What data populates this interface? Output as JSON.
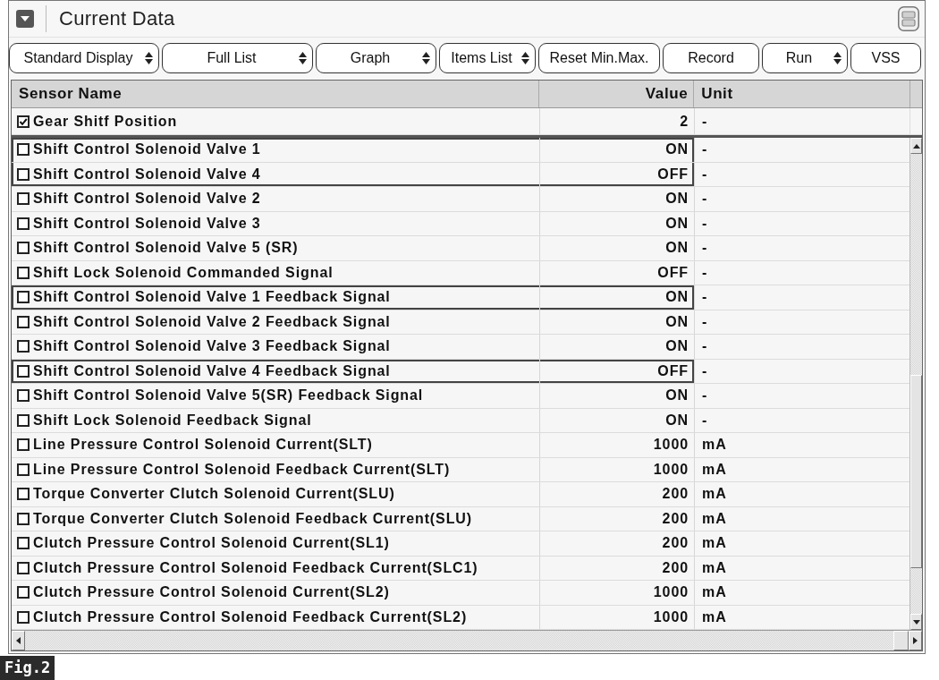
{
  "window": {
    "title": "Current Data"
  },
  "toolbar": [
    {
      "label": "Standard Display",
      "kind": "dropdown"
    },
    {
      "label": "Full List",
      "kind": "dropdown"
    },
    {
      "label": "Graph",
      "kind": "dropdown"
    },
    {
      "label": "Items List",
      "kind": "dropdown"
    },
    {
      "label": "Reset Min.Max.",
      "kind": "button"
    },
    {
      "label": "Record",
      "kind": "button"
    },
    {
      "label": "Run",
      "kind": "dropdown"
    },
    {
      "label": "VSS",
      "kind": "button"
    }
  ],
  "table": {
    "columns": [
      "Sensor Name",
      "Value",
      "Unit"
    ],
    "pinned_row": {
      "name": "Gear Shitf Position",
      "value": "2",
      "unit": "-",
      "checked": true
    },
    "rows": [
      {
        "name": "Shift Control Solenoid Valve 1",
        "value": "ON",
        "unit": "-",
        "checked": false,
        "highlighted": true
      },
      {
        "name": "Shift Control Solenoid Valve 4",
        "value": "OFF",
        "unit": "-",
        "checked": false,
        "highlighted": true
      },
      {
        "name": "Shift Control Solenoid Valve 2",
        "value": "ON",
        "unit": "-",
        "checked": false,
        "highlighted": false
      },
      {
        "name": "Shift Control Solenoid Valve 3",
        "value": "ON",
        "unit": "-",
        "checked": false,
        "highlighted": false
      },
      {
        "name": "Shift Control Solenoid Valve 5 (SR)",
        "value": "ON",
        "unit": "-",
        "checked": false,
        "highlighted": false
      },
      {
        "name": "Shift Lock Solenoid Commanded Signal",
        "value": "OFF",
        "unit": "-",
        "checked": false,
        "highlighted": false
      },
      {
        "name": "Shift Control Solenoid Valve 1 Feedback Signal",
        "value": "ON",
        "unit": "-",
        "checked": false,
        "highlighted": true
      },
      {
        "name": "Shift Control Solenoid Valve 2 Feedback Signal",
        "value": "ON",
        "unit": "-",
        "checked": false,
        "highlighted": false
      },
      {
        "name": "Shift Control Solenoid Valve 3 Feedback Signal",
        "value": "ON",
        "unit": "-",
        "checked": false,
        "highlighted": false
      },
      {
        "name": "Shift Control Solenoid Valve 4 Feedback Signal",
        "value": "OFF",
        "unit": "-",
        "checked": false,
        "highlighted": true
      },
      {
        "name": "Shift Control Solenoid Valve 5(SR) Feedback Signal",
        "value": "ON",
        "unit": "-",
        "checked": false,
        "highlighted": false
      },
      {
        "name": "Shift Lock Solenoid Feedback Signal",
        "value": "ON",
        "unit": "-",
        "checked": false,
        "highlighted": false
      },
      {
        "name": "Line Pressure Control Solenoid Current(SLT)",
        "value": "1000",
        "unit": "mA",
        "checked": false,
        "highlighted": false
      },
      {
        "name": "Line Pressure Control Solenoid Feedback Current(SLT)",
        "value": "1000",
        "unit": "mA",
        "checked": false,
        "highlighted": false
      },
      {
        "name": "Torque Converter Clutch Solenoid Current(SLU)",
        "value": "200",
        "unit": "mA",
        "checked": false,
        "highlighted": false
      },
      {
        "name": "Torque Converter Clutch Solenoid Feedback Current(SLU)",
        "value": "200",
        "unit": "mA",
        "checked": false,
        "highlighted": false
      },
      {
        "name": "Clutch Pressure Control Solenoid Current(SL1)",
        "value": "200",
        "unit": "mA",
        "checked": false,
        "highlighted": false
      },
      {
        "name": "Clutch Pressure Control Solenoid Feedback Current(SLC1)",
        "value": "200",
        "unit": "mA",
        "checked": false,
        "highlighted": false
      },
      {
        "name": "Clutch Pressure Control Solenoid Current(SL2)",
        "value": "1000",
        "unit": "mA",
        "checked": false,
        "highlighted": false
      },
      {
        "name": "Clutch Pressure Control Solenoid Feedback Current(SL2)",
        "value": "1000",
        "unit": "mA",
        "checked": false,
        "highlighted": false
      }
    ]
  },
  "figure_label": "Fig.2"
}
